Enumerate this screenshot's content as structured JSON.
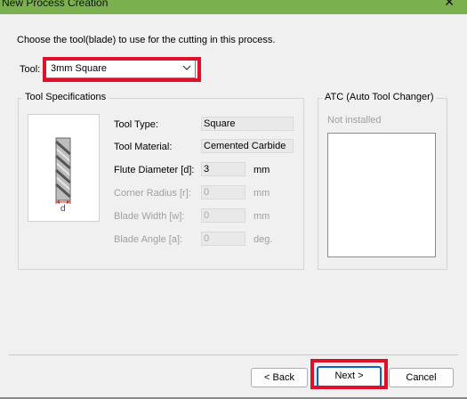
{
  "window": {
    "title": "New Process Creation",
    "close_glyph": "✕"
  },
  "instruction": "Choose the tool(blade) to use for the cutting in this process.",
  "tool": {
    "label": "Tool:",
    "selected": "3mm Square"
  },
  "specs": {
    "group_title": "Tool Specifications",
    "diagram_label": "d",
    "rows": [
      {
        "label": "Tool Type:",
        "value": "Square",
        "unit": ""
      },
      {
        "label": "Tool Material:",
        "value": "Cemented Carbide",
        "unit": ""
      },
      {
        "label": "Flute Diameter [d]:",
        "value": "3",
        "unit": "mm"
      },
      {
        "label": "Corner Radius [r]:",
        "value": "0",
        "unit": "mm"
      },
      {
        "label": "Blade Width [w]:",
        "value": "0",
        "unit": "mm"
      },
      {
        "label": "Blade Angle [a]:",
        "value": "0",
        "unit": "deg."
      }
    ]
  },
  "atc": {
    "group_title": "ATC (Auto Tool Changer)",
    "status": "Not installed"
  },
  "buttons": {
    "back": "< Back",
    "next": "Next >",
    "cancel": "Cancel"
  },
  "colors": {
    "titlebar": "#7ab04d",
    "highlight": "#e0102b",
    "focus": "#0a64c8"
  }
}
